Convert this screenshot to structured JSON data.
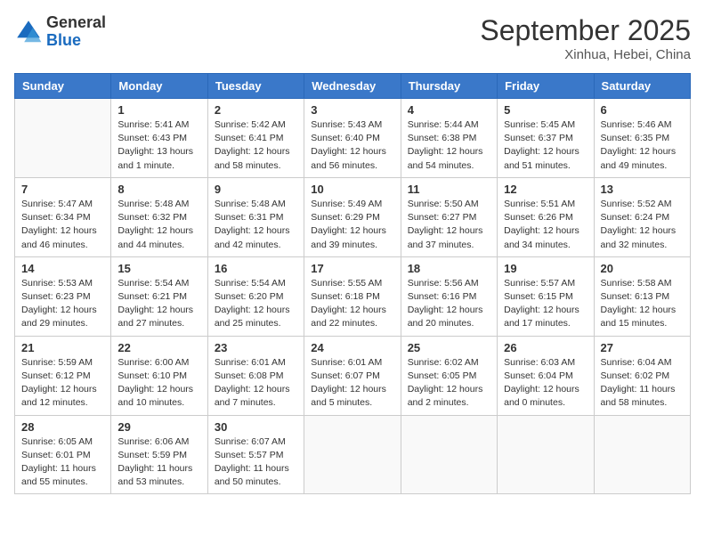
{
  "logo": {
    "general": "General",
    "blue": "Blue"
  },
  "header": {
    "month": "September 2025",
    "location": "Xinhua, Hebei, China"
  },
  "weekdays": [
    "Sunday",
    "Monday",
    "Tuesday",
    "Wednesday",
    "Thursday",
    "Friday",
    "Saturday"
  ],
  "weeks": [
    [
      {
        "day": "",
        "info": ""
      },
      {
        "day": "1",
        "info": "Sunrise: 5:41 AM\nSunset: 6:43 PM\nDaylight: 13 hours\nand 1 minute."
      },
      {
        "day": "2",
        "info": "Sunrise: 5:42 AM\nSunset: 6:41 PM\nDaylight: 12 hours\nand 58 minutes."
      },
      {
        "day": "3",
        "info": "Sunrise: 5:43 AM\nSunset: 6:40 PM\nDaylight: 12 hours\nand 56 minutes."
      },
      {
        "day": "4",
        "info": "Sunrise: 5:44 AM\nSunset: 6:38 PM\nDaylight: 12 hours\nand 54 minutes."
      },
      {
        "day": "5",
        "info": "Sunrise: 5:45 AM\nSunset: 6:37 PM\nDaylight: 12 hours\nand 51 minutes."
      },
      {
        "day": "6",
        "info": "Sunrise: 5:46 AM\nSunset: 6:35 PM\nDaylight: 12 hours\nand 49 minutes."
      }
    ],
    [
      {
        "day": "7",
        "info": "Sunrise: 5:47 AM\nSunset: 6:34 PM\nDaylight: 12 hours\nand 46 minutes."
      },
      {
        "day": "8",
        "info": "Sunrise: 5:48 AM\nSunset: 6:32 PM\nDaylight: 12 hours\nand 44 minutes."
      },
      {
        "day": "9",
        "info": "Sunrise: 5:48 AM\nSunset: 6:31 PM\nDaylight: 12 hours\nand 42 minutes."
      },
      {
        "day": "10",
        "info": "Sunrise: 5:49 AM\nSunset: 6:29 PM\nDaylight: 12 hours\nand 39 minutes."
      },
      {
        "day": "11",
        "info": "Sunrise: 5:50 AM\nSunset: 6:27 PM\nDaylight: 12 hours\nand 37 minutes."
      },
      {
        "day": "12",
        "info": "Sunrise: 5:51 AM\nSunset: 6:26 PM\nDaylight: 12 hours\nand 34 minutes."
      },
      {
        "day": "13",
        "info": "Sunrise: 5:52 AM\nSunset: 6:24 PM\nDaylight: 12 hours\nand 32 minutes."
      }
    ],
    [
      {
        "day": "14",
        "info": "Sunrise: 5:53 AM\nSunset: 6:23 PM\nDaylight: 12 hours\nand 29 minutes."
      },
      {
        "day": "15",
        "info": "Sunrise: 5:54 AM\nSunset: 6:21 PM\nDaylight: 12 hours\nand 27 minutes."
      },
      {
        "day": "16",
        "info": "Sunrise: 5:54 AM\nSunset: 6:20 PM\nDaylight: 12 hours\nand 25 minutes."
      },
      {
        "day": "17",
        "info": "Sunrise: 5:55 AM\nSunset: 6:18 PM\nDaylight: 12 hours\nand 22 minutes."
      },
      {
        "day": "18",
        "info": "Sunrise: 5:56 AM\nSunset: 6:16 PM\nDaylight: 12 hours\nand 20 minutes."
      },
      {
        "day": "19",
        "info": "Sunrise: 5:57 AM\nSunset: 6:15 PM\nDaylight: 12 hours\nand 17 minutes."
      },
      {
        "day": "20",
        "info": "Sunrise: 5:58 AM\nSunset: 6:13 PM\nDaylight: 12 hours\nand 15 minutes."
      }
    ],
    [
      {
        "day": "21",
        "info": "Sunrise: 5:59 AM\nSunset: 6:12 PM\nDaylight: 12 hours\nand 12 minutes."
      },
      {
        "day": "22",
        "info": "Sunrise: 6:00 AM\nSunset: 6:10 PM\nDaylight: 12 hours\nand 10 minutes."
      },
      {
        "day": "23",
        "info": "Sunrise: 6:01 AM\nSunset: 6:08 PM\nDaylight: 12 hours\nand 7 minutes."
      },
      {
        "day": "24",
        "info": "Sunrise: 6:01 AM\nSunset: 6:07 PM\nDaylight: 12 hours\nand 5 minutes."
      },
      {
        "day": "25",
        "info": "Sunrise: 6:02 AM\nSunset: 6:05 PM\nDaylight: 12 hours\nand 2 minutes."
      },
      {
        "day": "26",
        "info": "Sunrise: 6:03 AM\nSunset: 6:04 PM\nDaylight: 12 hours\nand 0 minutes."
      },
      {
        "day": "27",
        "info": "Sunrise: 6:04 AM\nSunset: 6:02 PM\nDaylight: 11 hours\nand 58 minutes."
      }
    ],
    [
      {
        "day": "28",
        "info": "Sunrise: 6:05 AM\nSunset: 6:01 PM\nDaylight: 11 hours\nand 55 minutes."
      },
      {
        "day": "29",
        "info": "Sunrise: 6:06 AM\nSunset: 5:59 PM\nDaylight: 11 hours\nand 53 minutes."
      },
      {
        "day": "30",
        "info": "Sunrise: 6:07 AM\nSunset: 5:57 PM\nDaylight: 11 hours\nand 50 minutes."
      },
      {
        "day": "",
        "info": ""
      },
      {
        "day": "",
        "info": ""
      },
      {
        "day": "",
        "info": ""
      },
      {
        "day": "",
        "info": ""
      }
    ]
  ]
}
